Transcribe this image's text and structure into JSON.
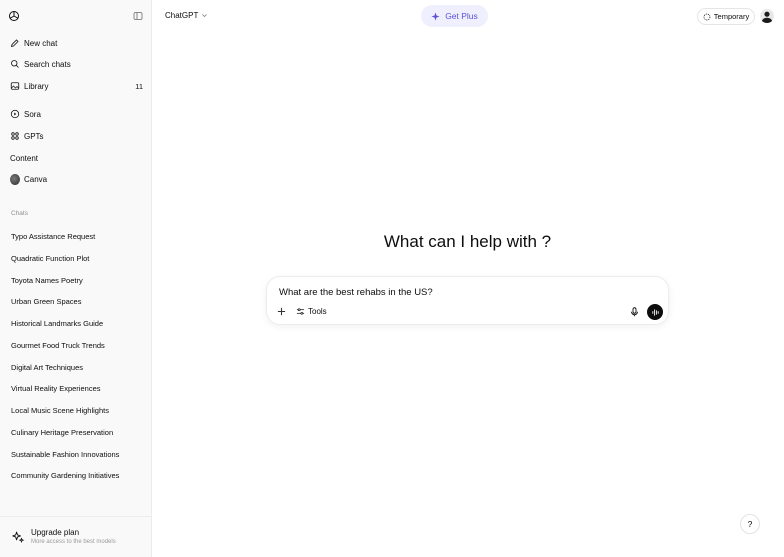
{
  "header": {
    "model_label": "ChatGPT",
    "get_plus_label": "Get Plus",
    "temporary_label": "Temporary"
  },
  "sidebar": {
    "nav": [
      {
        "label": "New chat",
        "icon": "pencil-icon"
      },
      {
        "label": "Search chats",
        "icon": "search-icon"
      },
      {
        "label": "Library",
        "icon": "image-icon",
        "count": "11"
      },
      {
        "label": "Sora",
        "icon": "play-circle-icon"
      },
      {
        "label": "GPTs",
        "icon": "grid-icon"
      },
      {
        "label": "Content",
        "icon": ""
      },
      {
        "label": "Canva",
        "icon": "canva-logo"
      }
    ],
    "chats_heading": "Chats",
    "chats": [
      "Typo Assistance Request",
      "Quadratic Function Plot",
      "Toyota Names Poetry",
      "Urban Green Spaces",
      "Historical Landmarks Guide",
      "Gourmet Food Truck Trends",
      "Digital Art Techniques",
      "Virtual Reality Experiences",
      "Local Music Scene Highlights",
      "Culinary Heritage Preservation",
      "Sustainable Fashion Innovations",
      "Community Gardening Initiatives"
    ],
    "upgrade": {
      "title": "Upgrade plan",
      "subtitle": "More access to the best models"
    }
  },
  "main": {
    "headline": "What can I help with ?",
    "composer": {
      "text": "What are the best rehabs in the US?",
      "tools_label": "Tools"
    },
    "help_label": "?"
  },
  "colors": {
    "accent": "#5b51d8",
    "sidebar_bg": "#f9f9f9"
  }
}
